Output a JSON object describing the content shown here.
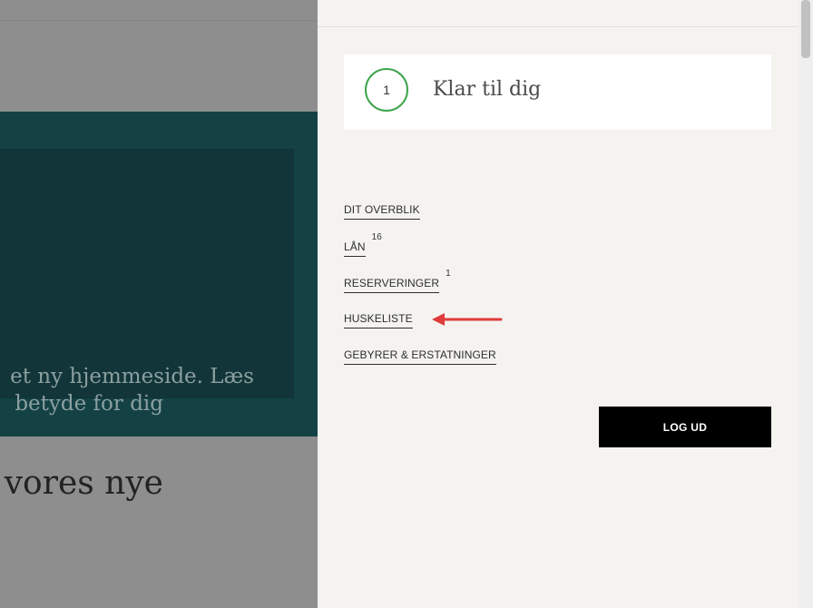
{
  "background": {
    "hero_line_1": "et ny hjemmeside. Læs",
    "hero_line_2": "betyde for dig",
    "heading_fragment": "vores nye"
  },
  "panel": {
    "ready": {
      "count": "1",
      "label": "Klar til dig"
    },
    "menu": [
      {
        "label": "DIT OVERBLIK",
        "badge": ""
      },
      {
        "label": "LÅN",
        "badge": "16"
      },
      {
        "label": "RESERVERINGER",
        "badge": "1"
      },
      {
        "label": "HUSKELISTE",
        "badge": ""
      },
      {
        "label": "GEBYRER & ERSTATNINGER",
        "badge": ""
      }
    ],
    "logout_label": "LOG UD"
  },
  "colors": {
    "hero_bg": "#134144",
    "ready_ring": "#3ea54c",
    "arrow": "#e03b3b",
    "logout_bg": "#000000"
  }
}
